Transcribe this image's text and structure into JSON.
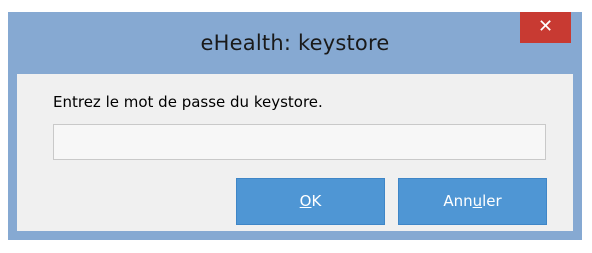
{
  "window": {
    "title": "eHealth: keystore",
    "close_symbol": "✕"
  },
  "dialog": {
    "prompt": "Entrez le mot de passe du keystore.",
    "password_value": "",
    "ok_button": {
      "mnemonic": "O",
      "rest": "K"
    },
    "cancel_button": {
      "before": "Ann",
      "mnemonic": "u",
      "after": "ler"
    }
  },
  "colors": {
    "frame": "#86a9d2",
    "close_button": "#c83a32",
    "button": "#4f96d4",
    "client": "#f0f0f0"
  },
  "icons": {
    "close": "close-icon"
  }
}
